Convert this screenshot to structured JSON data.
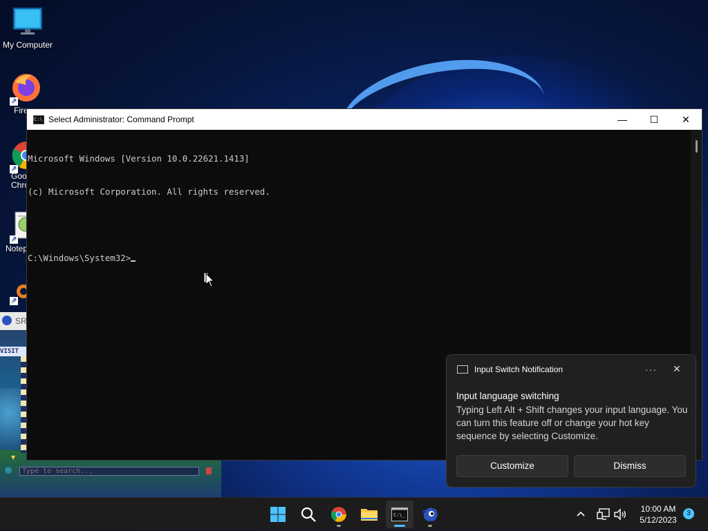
{
  "desktop": {
    "icons": [
      {
        "label": "My Computer",
        "icon": "monitor-icon"
      },
      {
        "label": "Fire",
        "icon": "firefox-icon"
      },
      {
        "label": "Goo Chro",
        "icon": "chrome-icon"
      },
      {
        "label": "Notep",
        "icon": "notepad-icon"
      },
      {
        "label": "",
        "icon": "app-shortcut-icon"
      }
    ]
  },
  "game_window": {
    "tab_label": "SR",
    "visit_label": "VISIT",
    "search_placeholder": "Type to search..."
  },
  "cmd": {
    "title": "Select Administrator: Command Prompt",
    "lines": [
      "Microsoft Windows [Version 10.0.22621.1413]",
      "(c) Microsoft Corporation. All rights reserved.",
      "",
      "C:\\Windows\\System32>"
    ],
    "minimize": "—",
    "maximize": "☐",
    "close": "✕"
  },
  "notification": {
    "app": "Input Switch Notification",
    "more": "···",
    "close": "✕",
    "title": "Input language switching",
    "body": "Typing Left Alt + Shift changes your input language. You can turn this feature off or change your hot key sequence by selecting Customize.",
    "buttons": {
      "customize": "Customize",
      "dismiss": "Dismiss"
    }
  },
  "taskbar": {
    "items": [
      "start-icon",
      "search-icon",
      "chrome-icon",
      "file-explorer-icon",
      "command-prompt-icon",
      "sonic-game-icon"
    ],
    "active": "command-prompt-icon",
    "tray": {
      "chevron": "^",
      "network": "network-icon",
      "volume": "volume-icon"
    },
    "time": "10:00 AM",
    "date": "5/12/2023",
    "notification_count": "3"
  },
  "colors": {
    "accent": "#4cc2ff",
    "console_bg": "#0c0c0c",
    "console_text": "#cccccc",
    "toast_bg": "#202020"
  }
}
